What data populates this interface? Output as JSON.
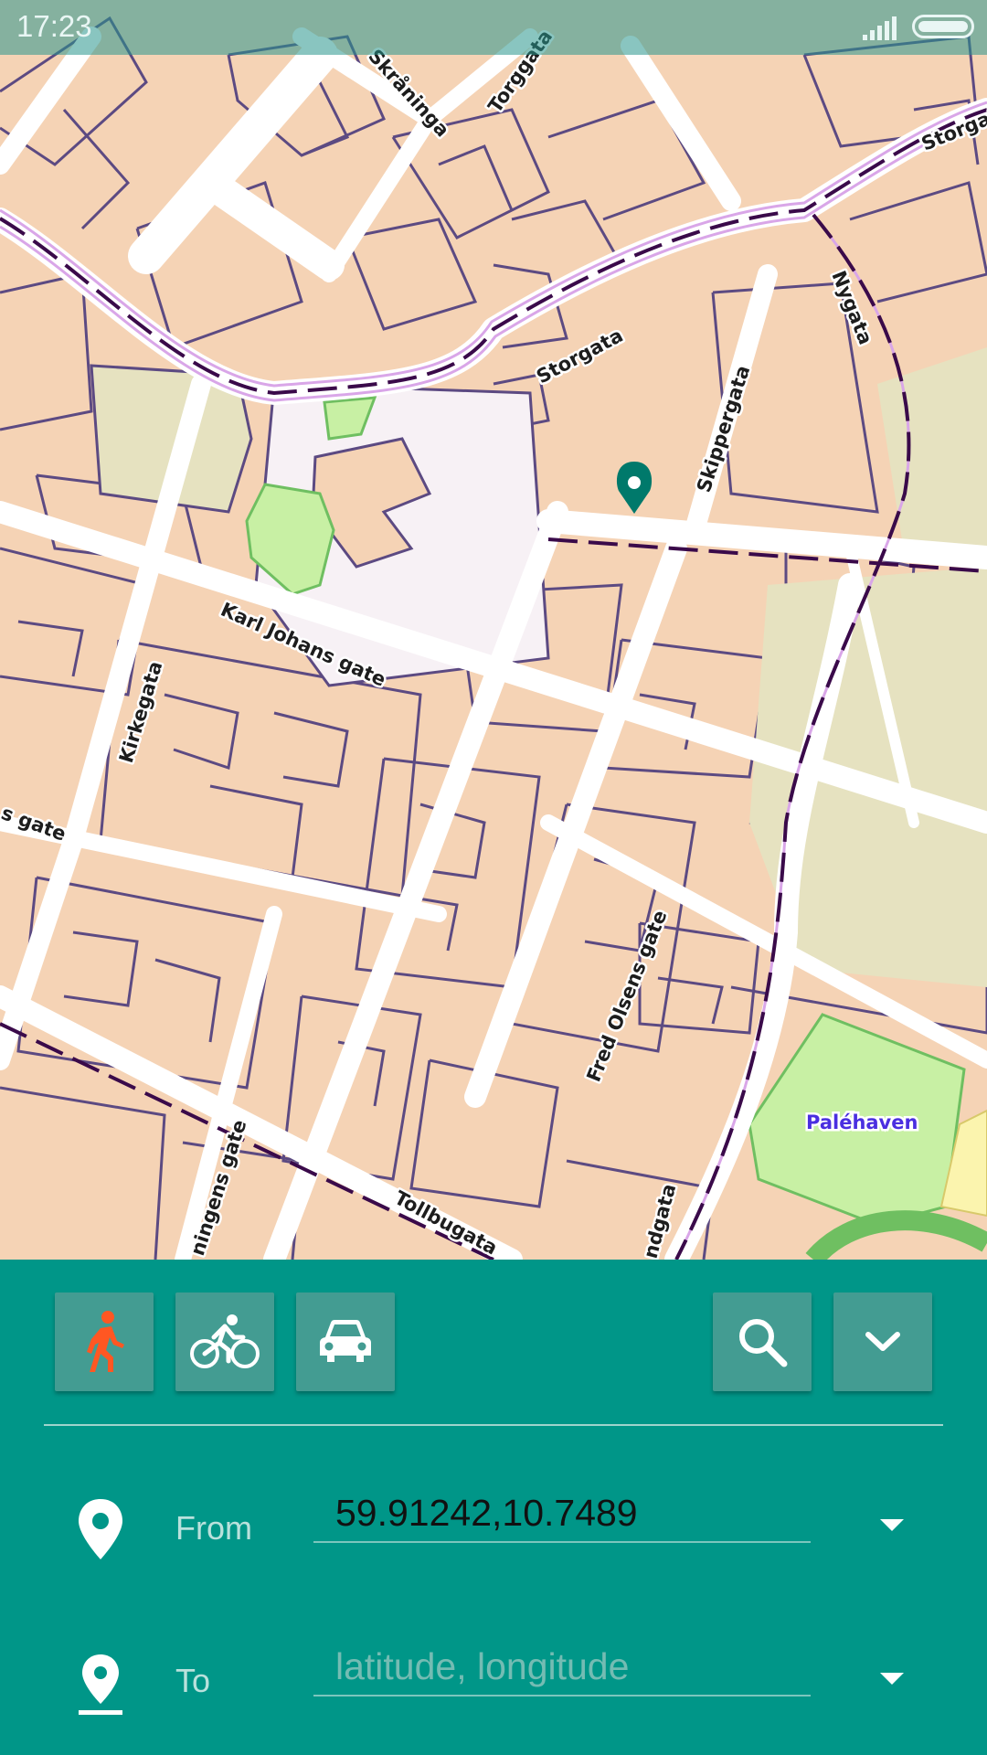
{
  "status_bar": {
    "time": "17:23",
    "signal_icon": "signal-icon",
    "battery_icon": "battery-icon"
  },
  "map": {
    "street_labels": {
      "skraninga": "Skråninga",
      "torggata": "Torggata",
      "storgata_top": "Storgata",
      "storgata": "Storgata",
      "nygata": "Nygata",
      "skippergata": "Skippergata",
      "karl_johans_gate": "Karl Johans gate",
      "kirkegata": "Kirkegata",
      "s_gate": "s gate",
      "fred_olsens_gate": "Fred Olsens gate",
      "ningens_gate": "ningens gate",
      "tollbugata": "Tollbugata",
      "ndgata": "ndgata"
    },
    "park_label": "Paléhaven",
    "marker_icon": "map-marker-icon",
    "colors": {
      "building": "#f5d3b5",
      "outline": "#5c4a82",
      "road": "#ffffff",
      "park": "#c8f0a4",
      "tram": "#3a0a4a"
    }
  },
  "panel": {
    "modes": [
      {
        "name": "walk",
        "icon": "walk-icon",
        "selected": true
      },
      {
        "name": "bike",
        "icon": "bike-icon",
        "selected": false
      },
      {
        "name": "car",
        "icon": "car-icon",
        "selected": false
      }
    ],
    "search_icon": "search-icon",
    "collapse_icon": "chevron-down-icon",
    "from": {
      "label": "From",
      "value": "59.91242,10.7489",
      "icon": "location-pin-icon"
    },
    "to": {
      "label": "To",
      "value": "",
      "placeholder": "latitude, longitude",
      "icon": "location-pin-underlined-icon"
    },
    "colors": {
      "panel": "#009688",
      "button": "#439c92",
      "active_mode": "#ff5722"
    }
  }
}
